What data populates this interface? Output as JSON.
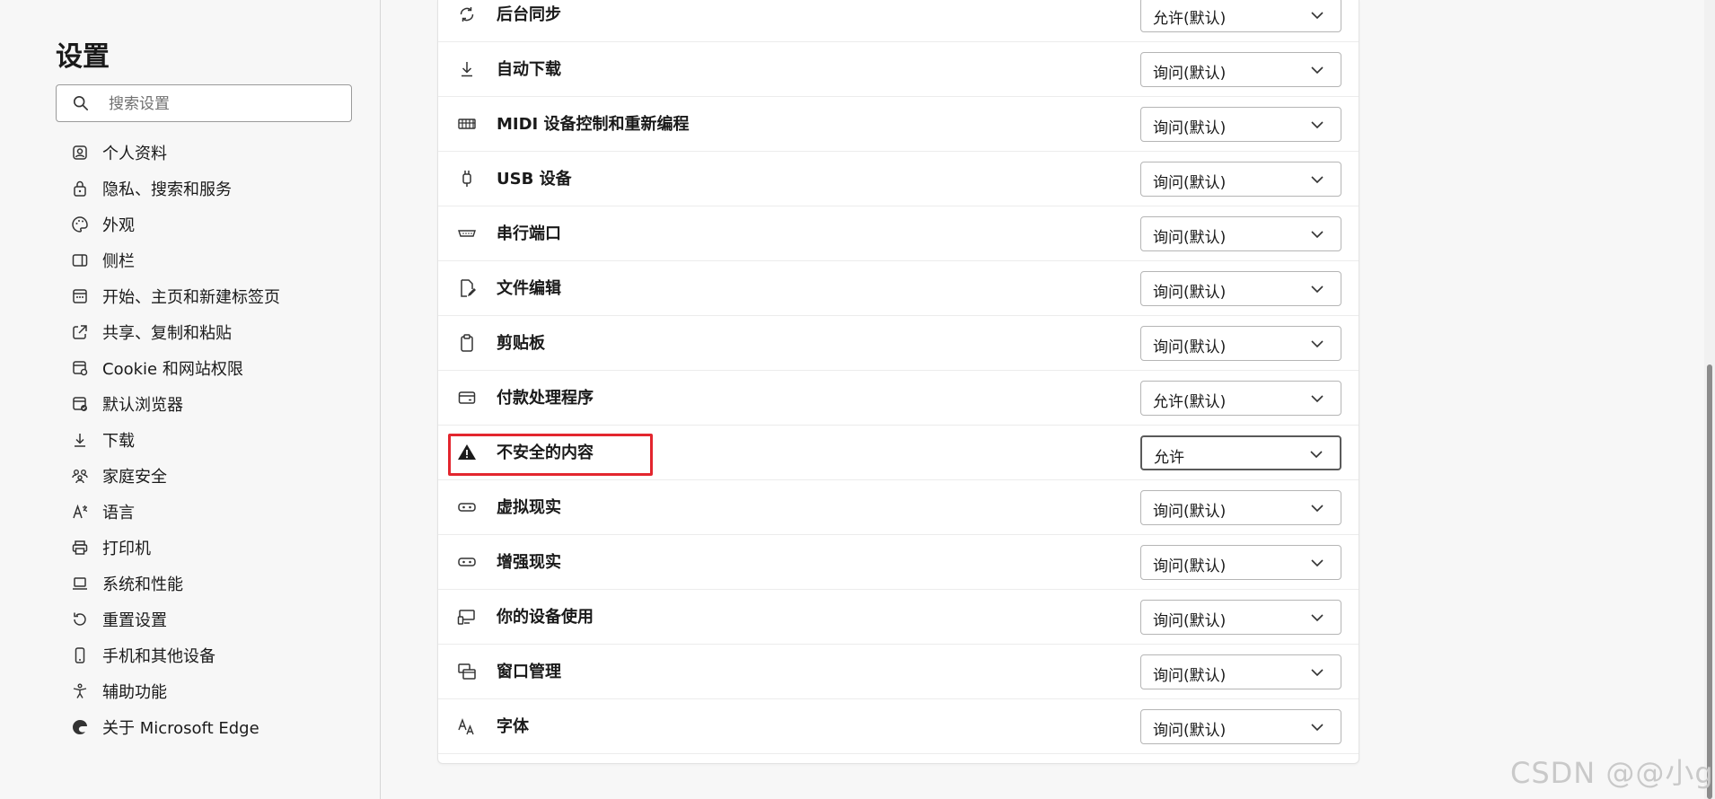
{
  "sidebar": {
    "title": "设置",
    "search_placeholder": "搜索设置",
    "items": [
      {
        "label": "个人资料",
        "icon": "profile-icon"
      },
      {
        "label": "隐私、搜索和服务",
        "icon": "lock-icon"
      },
      {
        "label": "外观",
        "icon": "palette-icon"
      },
      {
        "label": "侧栏",
        "icon": "sidebar-icon"
      },
      {
        "label": "开始、主页和新建标签页",
        "icon": "home-tabs-icon"
      },
      {
        "label": "共享、复制和粘贴",
        "icon": "share-icon"
      },
      {
        "label": "Cookie 和网站权限",
        "icon": "cookie-permissions-icon"
      },
      {
        "label": "默认浏览器",
        "icon": "default-browser-icon"
      },
      {
        "label": "下载",
        "icon": "download-icon"
      },
      {
        "label": "家庭安全",
        "icon": "family-icon"
      },
      {
        "label": "语言",
        "icon": "language-icon"
      },
      {
        "label": "打印机",
        "icon": "printer-icon"
      },
      {
        "label": "系统和性能",
        "icon": "laptop-icon"
      },
      {
        "label": "重置设置",
        "icon": "reset-icon"
      },
      {
        "label": "手机和其他设备",
        "icon": "phone-icon"
      },
      {
        "label": "辅助功能",
        "icon": "accessibility-icon"
      },
      {
        "label": "关于 Microsoft Edge",
        "icon": "edge-logo-icon"
      }
    ]
  },
  "permissions": [
    {
      "label": "后台同步",
      "value": "允许(默认)",
      "icon": "sync-icon"
    },
    {
      "label": "自动下载",
      "value": "询问(默认)",
      "icon": "download-icon"
    },
    {
      "label": "MIDI 设备控制和重新编程",
      "value": "询问(默认)",
      "icon": "midi-keyboard-icon"
    },
    {
      "label": "USB 设备",
      "value": "询问(默认)",
      "icon": "usb-icon"
    },
    {
      "label": "串行端口",
      "value": "询问(默认)",
      "icon": "serial-port-icon"
    },
    {
      "label": "文件编辑",
      "value": "询问(默认)",
      "icon": "file-edit-icon"
    },
    {
      "label": "剪贴板",
      "value": "询问(默认)",
      "icon": "clipboard-icon"
    },
    {
      "label": "付款处理程序",
      "value": "允许(默认)",
      "icon": "card-icon"
    },
    {
      "label": "不安全的内容",
      "value": "允许",
      "icon": "warning-icon"
    },
    {
      "label": "虚拟现实",
      "value": "询问(默认)",
      "icon": "vr-headset-icon"
    },
    {
      "label": "增强现实",
      "value": "询问(默认)",
      "icon": "ar-headset-icon"
    },
    {
      "label": "你的设备使用",
      "value": "询问(默认)",
      "icon": "device-use-icon"
    },
    {
      "label": "窗口管理",
      "value": "询问(默认)",
      "icon": "window-management-icon"
    },
    {
      "label": "字体",
      "value": "询问(默认)",
      "icon": "font-icon"
    }
  ],
  "watermark": "CSDN @@小g",
  "colors": {
    "highlight": "#e3262e"
  }
}
